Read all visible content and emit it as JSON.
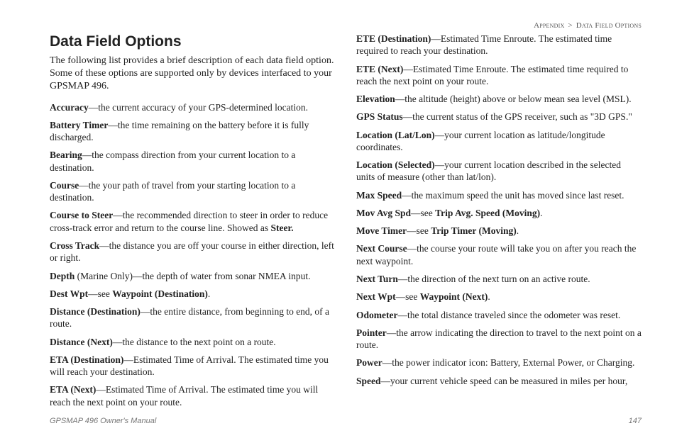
{
  "breadcrumb": {
    "section": "Appendix",
    "sep": ">",
    "sub": "Data Field Options"
  },
  "title": "Data Field Options",
  "intro": "The following list provides a brief description of each data field option. Some of these options are supported only by devices interfaced to your GPSMAP 496.",
  "entries": [
    {
      "term": "Accuracy",
      "desc": "—the current accuracy of your GPS-determined location."
    },
    {
      "term": "Battery Timer",
      "desc": "—the time remaining on the battery before it is fully discharged."
    },
    {
      "term": "Bearing",
      "desc": "—the compass direction from your current location to a destination."
    },
    {
      "term": "Course",
      "desc": "—the your path of travel from your starting location to a destination."
    },
    {
      "term": "Course to Steer",
      "desc": "—the recommended direction to steer in order to reduce cross-track error and return to the course line. Showed as ",
      "tail_bold": "Steer."
    },
    {
      "term": "Cross Track",
      "desc": "—the distance you are off your course in either direction, left or right."
    },
    {
      "term": "Depth",
      "desc": " (Marine Only)—the depth of water from sonar NMEA input.",
      "term_nobold_suffix": true
    },
    {
      "term": "Dest Wpt",
      "desc": "—see ",
      "tail_bold": "Waypoint (Destination)",
      "tail_after": "."
    },
    {
      "term": "Distance (Destination)",
      "desc": "—the entire distance, from beginning to end, of a route."
    },
    {
      "term": "Distance (Next)",
      "desc": "—the distance to the next point on a route."
    },
    {
      "term": "ETA (Destination)",
      "desc": "—Estimated Time of Arrival. The estimated time you will reach your destination."
    },
    {
      "term": "ETA (Next)",
      "desc": "—Estimated Time of Arrival. The estimated time you will reach the next point on your route."
    },
    {
      "term": "ETE (Destination)",
      "desc": "—Estimated Time Enroute. The estimated time required to reach your destination."
    },
    {
      "term": "ETE (Next)",
      "desc": "—Estimated Time Enroute. The estimated time required to reach the next point on your route."
    },
    {
      "term": "Elevation",
      "desc": "—the altitude (height) above or below mean sea level (MSL)."
    },
    {
      "term": "GPS Status",
      "desc": "—the current status of the GPS receiver, such as \"3D GPS.\""
    },
    {
      "term": "Location (Lat/Lon)",
      "desc": "—your current location as latitude/longitude coordinates."
    },
    {
      "term": "Location (Selected)",
      "desc": "—your current location described in the selected units of measure (other than lat/lon)."
    },
    {
      "term": "Max Speed",
      "desc": "—the maximum speed the unit has moved since last reset."
    },
    {
      "term": "Mov Avg Spd",
      "desc": "—see ",
      "tail_bold": "Trip Avg. Speed (Moving)",
      "tail_after": "."
    },
    {
      "term": "Move Timer",
      "desc": "—see ",
      "tail_bold": "Trip Timer (Moving)",
      "tail_after": "."
    },
    {
      "term": "Next Course",
      "desc": "—the course your route will take you on after you reach the next waypoint."
    },
    {
      "term": "Next Turn",
      "desc": "—the direction of the next turn on an active route."
    },
    {
      "term": "Next Wpt",
      "desc": "—see ",
      "tail_bold": "Waypoint (Next)",
      "tail_after": "."
    },
    {
      "term": "Odometer",
      "desc": "—the total distance traveled since the odometer was reset."
    },
    {
      "term": "Pointer",
      "desc": "—the arrow indicating the direction to travel to the next point on a route."
    },
    {
      "term": "Power",
      "desc": "—the power indicator icon: Battery, External Power, or Charging."
    },
    {
      "term": "Speed",
      "desc": "—your current vehicle speed can be measured in miles per hour,"
    }
  ],
  "footer": {
    "left": "GPSMAP 496 Owner's Manual",
    "right": "147"
  }
}
